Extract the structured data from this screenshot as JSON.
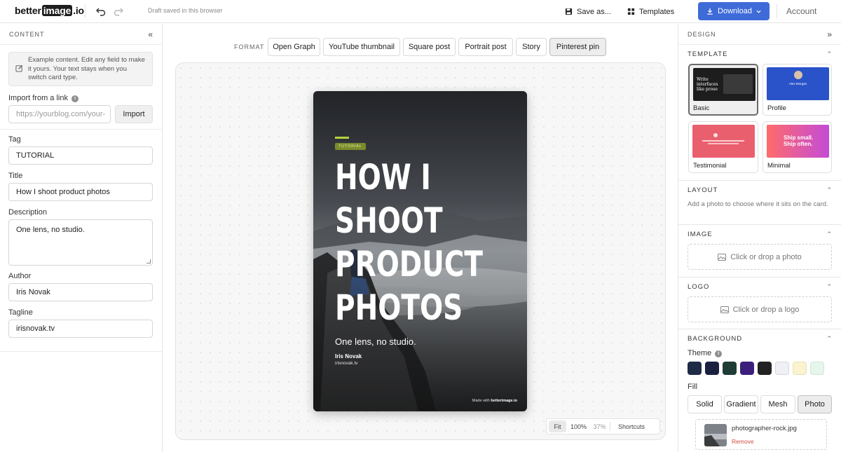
{
  "app": {
    "logo_pre": "better",
    "logo_hl": "image",
    "logo_post": ".io",
    "draft_status": "Draft saved in this browser",
    "save_as": "Save as...",
    "templates": "Templates",
    "download": "Download",
    "account": "Account"
  },
  "content": {
    "heading": "CONTENT",
    "note": "Example content. Edit any field to make it yours. Your text stays when you switch card type.",
    "import_label": "Import from a link",
    "import_placeholder": "https://yourblog.com/your-",
    "import_button": "Import",
    "tag_label": "Tag",
    "tag_value": "TUTORIAL",
    "title_label": "Title",
    "title_value": "How I shoot product photos",
    "description_label": "Description",
    "description_value": "One lens, no studio.",
    "author_label": "Author",
    "author_value": "Iris Novak",
    "tagline_label": "Tagline",
    "tagline_value": "irisnovak.tv"
  },
  "format": {
    "label": "FORMAT",
    "options": [
      "Open Graph",
      "YouTube thumbnail",
      "Square post",
      "Portrait post",
      "Story",
      "Pinterest pin"
    ],
    "selected": "Pinterest pin"
  },
  "card": {
    "tag": "TUTORIAL",
    "title_lines": [
      "HOW I",
      "SHOOT",
      "PRODUCT",
      "PHOTOS"
    ],
    "description": "One lens, no studio.",
    "author": "Iris Novak",
    "tagline": "irisnovak.tv",
    "made_with": "Made with",
    "made_with_brand": "betterimage.io",
    "accent_color": "#b4d33a"
  },
  "zoom": {
    "fit": "Fit",
    "p100": "100%",
    "current": "37%",
    "shortcuts": "Shortcuts"
  },
  "design": {
    "heading": "DESIGN",
    "template_heading": "TEMPLATE",
    "templates": [
      {
        "label": "Basic",
        "preview_text": "Write interfaces like prose"
      },
      {
        "label": "Profile",
        "preview_text": "Alex Morgan"
      },
      {
        "label": "Testimonial",
        "preview_text": ""
      },
      {
        "label": "Minimal",
        "preview_text": "Ship small. Ship often."
      }
    ],
    "selected_template": "Basic",
    "layout_heading": "LAYOUT",
    "layout_hint": "Add a photo to choose where it sits on the card.",
    "image_heading": "IMAGE",
    "image_drop": "Click or drop a photo",
    "logo_heading": "LOGO",
    "logo_drop": "Click or drop a logo",
    "background_heading": "BACKGROUND",
    "theme_label": "Theme",
    "theme_colors": [
      "#1e2b45",
      "#1b2040",
      "#1f3b36",
      "#3b1f7a",
      "#222222",
      "#eef0f6",
      "#fbf3cf",
      "#e6f6ea"
    ],
    "fill_label": "Fill",
    "fill_options": [
      "Solid",
      "Gradient",
      "Mesh",
      "Photo"
    ],
    "fill_selected": "Photo",
    "photo_filename": "photographer-rock.jpg",
    "photo_remove": "Remove"
  }
}
